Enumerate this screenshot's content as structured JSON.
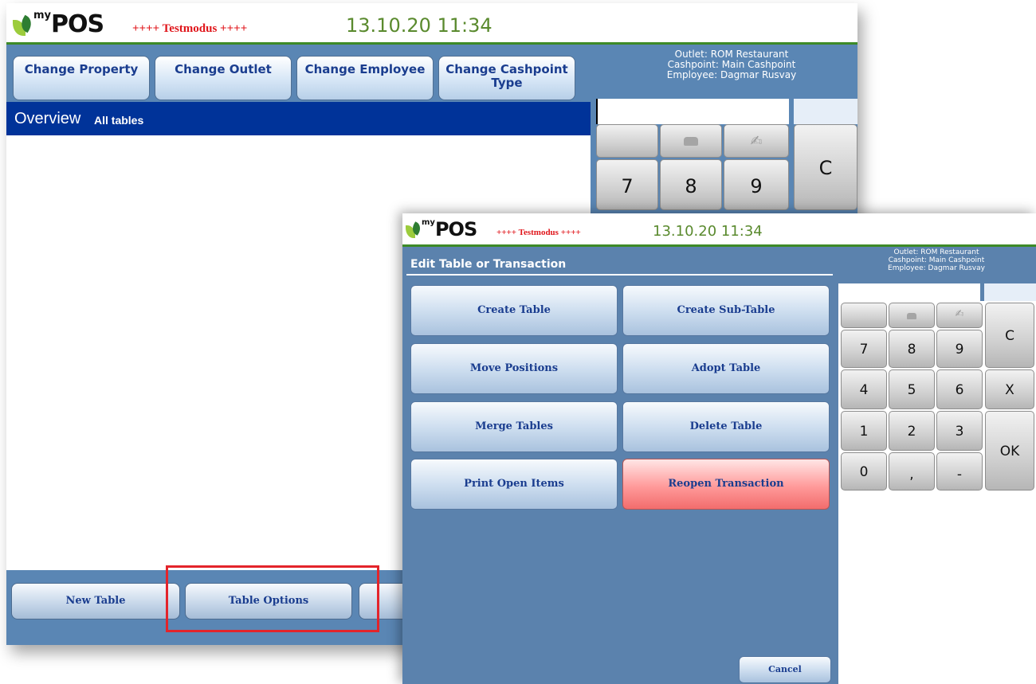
{
  "colors": {
    "accent_green": "#3d8a27",
    "header_blue": "#003399",
    "panel_blue": "#5a86b4",
    "danger_red": "#ff9a9a",
    "testmode_red": "#e0161b"
  },
  "background_window": {
    "logo": {
      "prefix": "my",
      "name": "POS"
    },
    "testmode": "++++ Testmodus ++++",
    "datetime": "13.10.20  11:34",
    "top_buttons": [
      {
        "label": "Change Property"
      },
      {
        "label": "Change Outlet"
      },
      {
        "label": "Change Employee"
      },
      {
        "label": "Change Cashpoint Type"
      }
    ],
    "info": {
      "outlet": "Outlet: ROM Restaurant",
      "cashpoint": "Cashpoint: Main Cashpoint",
      "employee": "Employee: Dagmar Rusvay"
    },
    "overview_title": "Overview",
    "overview_filter": "All tables",
    "keypad": {
      "k7": "7",
      "k8": "8",
      "k9": "9",
      "clear": "C"
    },
    "bottom_buttons": [
      {
        "label": "New Table"
      },
      {
        "label": "Table Options"
      }
    ]
  },
  "dialog": {
    "logo": {
      "prefix": "my",
      "name": "POS"
    },
    "testmode": "++++ Testmodus ++++",
    "datetime": "13.10.20  11:34",
    "title": "Edit Table or Transaction",
    "info": {
      "outlet": "Outlet: ROM Restaurant",
      "cashpoint": "Cashpoint: Main Cashpoint",
      "employee": "Employee: Dagmar Rusvay"
    },
    "options": [
      {
        "label": "Create Table"
      },
      {
        "label": "Create Sub-Table"
      },
      {
        "label": "Move Positions"
      },
      {
        "label": "Adopt Table"
      },
      {
        "label": "Merge Tables"
      },
      {
        "label": "Delete Table"
      },
      {
        "label": "Print Open Items"
      },
      {
        "label": "Reopen Transaction"
      }
    ],
    "cancel_label": "Cancel",
    "keypad": {
      "k7": "7",
      "k8": "8",
      "k9": "9",
      "k4": "4",
      "k5": "5",
      "k6": "6",
      "k1": "1",
      "k2": "2",
      "k3": "3",
      "k0": "0",
      "comma": ",",
      "minus": "-",
      "clear": "C",
      "cancel": "X",
      "ok": "OK"
    }
  }
}
